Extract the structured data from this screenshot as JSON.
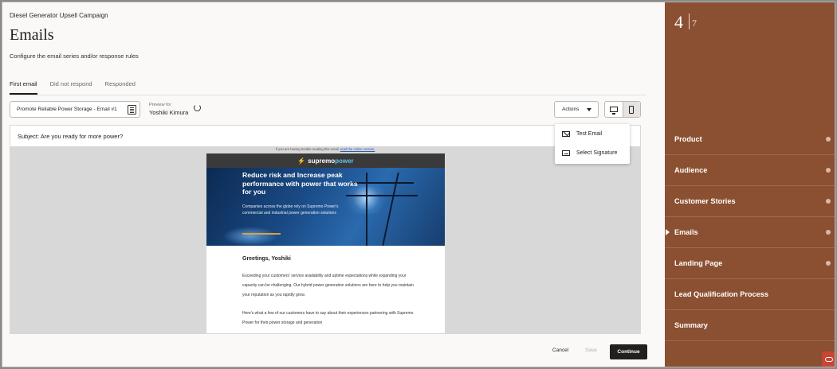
{
  "header": {
    "campaign_name": "Diesel Generator Upsell Campaign",
    "title": "Emails",
    "subtitle": "Configure the email series and/or response rules"
  },
  "tabs": [
    {
      "label": "First email",
      "active": true
    },
    {
      "label": "Did not respond",
      "active": false
    },
    {
      "label": "Responded",
      "active": false
    }
  ],
  "toolbar": {
    "email_select_value": "Promote Reliable Power Storage - Email #1",
    "preview_for_label": "Preview for",
    "preview_for_name": "Yoshiki Kimura",
    "actions_label": "Actions"
  },
  "actions_menu": [
    {
      "label": "Test Email",
      "icon": "mail-icon"
    },
    {
      "label": "Select Signature",
      "icon": "signature-icon"
    }
  ],
  "subject": "Subject: Are you ready for more power?",
  "email_preview": {
    "browser_note_prefix": "If you are having trouble reading this email, ",
    "browser_note_link": "read the online version.",
    "logo_prefix": "supremo",
    "logo_suffix": "power",
    "hero_title": "Reduce risk and Increase peak performance with power that works for you",
    "hero_text": "Companies across the globe rely on Supremo Power's commercial and industrial power generation solutions",
    "greeting": "Greetings, Yoshiki",
    "paragraph1": "Exceeding your customers' service availability and uptime expectations while expanding your capacity can be challenging. Our hybrid power generation solutions are here to help you maintain your reputation as you rapidly grow.",
    "paragraph2": "Here's what a few of our customers have to say about their experiences partnering with Supremo Power for their power storage and generation"
  },
  "footer_buttons": {
    "cancel": "Cancel",
    "save": "Save",
    "continue": "Continue"
  },
  "sidebar": {
    "current_step": "4",
    "total_steps": "7",
    "steps": [
      {
        "label": "Product",
        "completed": true,
        "current": false
      },
      {
        "label": "Audience",
        "completed": true,
        "current": false
      },
      {
        "label": "Customer Stories",
        "completed": true,
        "current": false
      },
      {
        "label": "Emails",
        "completed": true,
        "current": true
      },
      {
        "label": "Landing Page",
        "completed": true,
        "current": false
      },
      {
        "label": "Lead Qualification Process",
        "completed": false,
        "current": false
      },
      {
        "label": "Summary",
        "completed": false,
        "current": false
      }
    ]
  },
  "colors": {
    "sidebar_bg": "#8b4f31",
    "primary_button": "#231f1c",
    "brand_accent": "#5fc2e8",
    "oracle_red": "#c74634"
  }
}
